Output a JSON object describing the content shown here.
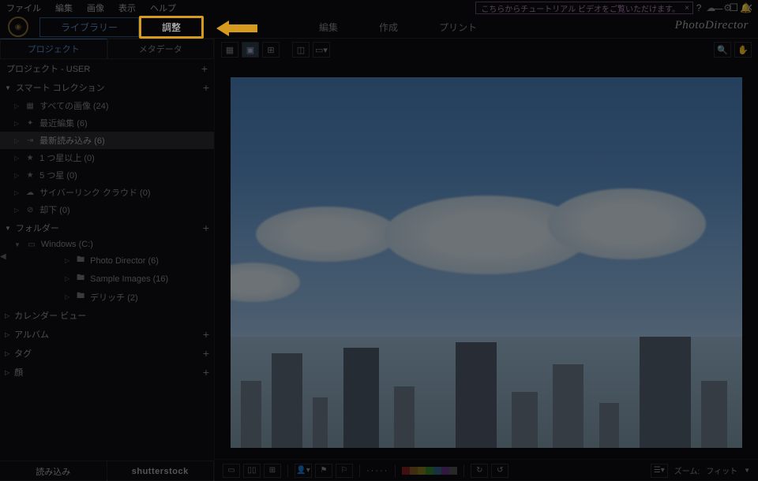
{
  "menubar": {
    "items": [
      "ファイル",
      "編集",
      "画像",
      "表示",
      "ヘルプ"
    ],
    "tutorial_text": "こちらからチュートリアル ビデオをご覧いただけます。",
    "app_title": "PhotoDirector"
  },
  "modules": {
    "library": "ライブラリー",
    "adjust": "調整",
    "edit": "編集",
    "create": "作成",
    "print": "プリント"
  },
  "sidebar": {
    "tabs": {
      "project": "プロジェクト",
      "metadata": "メタデータ"
    },
    "project_header": "プロジェクト - USER",
    "smart_collection": {
      "label": "スマート コレクション",
      "items": [
        {
          "label": "すべての画像 (24)",
          "icon": "grid"
        },
        {
          "label": "最近編集 (6)",
          "icon": "wand"
        },
        {
          "label": "最新読み込み (6)",
          "icon": "import",
          "selected": true
        },
        {
          "label": "1 つ星以上 (0)",
          "icon": "star"
        },
        {
          "label": "5 つ星 (0)",
          "icon": "star"
        },
        {
          "label": "サイバーリンク クラウド (0)",
          "icon": "cloud"
        },
        {
          "label": "却下 (0)",
          "icon": "reject"
        }
      ]
    },
    "folder": {
      "label": "フォルダー",
      "root": "Windows (C:)",
      "children": [
        {
          "label": "Photo Director (6)"
        },
        {
          "label": "Sample Images (16)"
        },
        {
          "label": "デリッチ (2)"
        }
      ]
    },
    "calendar": "カレンダー ビュー",
    "album": "アルバム",
    "tag": "タグ",
    "face": "顔",
    "footer": {
      "import": "読み込み",
      "shutterstock": "shutterstock"
    }
  },
  "bottombar": {
    "zoom_label": "ズーム:",
    "zoom_value": "フィット",
    "colors": [
      "#802020",
      "#805820",
      "#807820",
      "#308030",
      "#306080",
      "#603080",
      "#505050"
    ]
  }
}
